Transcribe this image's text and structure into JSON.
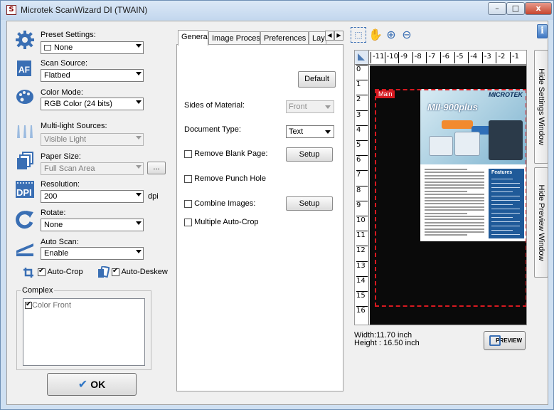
{
  "window": {
    "title": "Microtek ScanWizard DI (TWAIN)",
    "app_icon_glyph": "S",
    "min_glyph": "–",
    "max_glyph": "□",
    "close_glyph": "x"
  },
  "left_panel": {
    "preset": {
      "label": "Preset Settings:",
      "value": "None",
      "icon": "gear-icon"
    },
    "scan_source": {
      "label": "Scan Source:",
      "value": "Flatbed",
      "icon": "af-icon"
    },
    "color_mode": {
      "label": "Color Mode:",
      "value": "RGB Color (24 bits)",
      "icon": "palette-icon"
    },
    "multi_light": {
      "label": "Multi-light Sources:",
      "value": "Visible Light",
      "icon": "light-bars-icon",
      "enabled": false
    },
    "paper_size": {
      "label": "Paper Size:",
      "value": "Full Scan Area",
      "more_label": "...",
      "icon": "paper-stack-icon",
      "enabled": false
    },
    "resolution": {
      "label": "Resolution:",
      "value": "200",
      "unit": "dpi",
      "icon": "dpi-icon"
    },
    "rotate": {
      "label": "Rotate:",
      "value": "None",
      "icon": "rotate-icon"
    },
    "auto_scan": {
      "label": "Auto Scan:",
      "value": "Enable",
      "icon": "scanner-icon"
    },
    "auto_crop": {
      "label": "Auto-Crop",
      "checked": true
    },
    "auto_deskew": {
      "label": "Auto-Deskew",
      "checked": true
    },
    "complex": {
      "label": "Complex",
      "items": [
        {
          "label": "Color Front",
          "checked": true
        }
      ]
    },
    "ok_label": "OK",
    "ok_glyph": "✔"
  },
  "tabs": [
    {
      "label": "General",
      "active": true
    },
    {
      "label": "Image Process",
      "active": false
    },
    {
      "label": "Preferences",
      "active": false
    },
    {
      "label": "Layo",
      "active": false
    }
  ],
  "tab_nav": {
    "prev": "◀",
    "next": "▶"
  },
  "general": {
    "default_label": "Default",
    "sides_of_material": {
      "label": "Sides of Material:",
      "value": "Front",
      "enabled": false
    },
    "document_type": {
      "label": "Document Type:",
      "value": "Text"
    },
    "remove_blank_page": {
      "label": "Remove Blank Page:",
      "checked": false,
      "setup_label": "Setup"
    },
    "remove_punch_hole": {
      "label": "Remove Punch Hole",
      "checked": false
    },
    "combine_images": {
      "label": "Combine Images:",
      "checked": false,
      "setup_label": "Setup"
    },
    "multiple_auto_crop": {
      "label": "Multiple Auto-Crop",
      "checked": false
    }
  },
  "preview": {
    "tools": [
      "select-frame-icon",
      "hand-icon",
      "zoom-in-icon",
      "zoom-out-icon"
    ],
    "tool_glyphs": {
      "select": "⬚",
      "hand": "✋",
      "zoom_in": "⊕",
      "zoom_out": "⊖"
    },
    "h_ruler": [
      "-11",
      "-10",
      "-9",
      "-8",
      "-7",
      "-6",
      "-5",
      "-4",
      "-3",
      "-2",
      "-1"
    ],
    "v_ruler": [
      "0",
      "1",
      "2",
      "3",
      "4",
      "5",
      "6",
      "7",
      "8",
      "9",
      "10",
      "11",
      "12",
      "13",
      "14",
      "15",
      "16"
    ],
    "frame_label": "Main",
    "doc_brand": "MICROTEK",
    "doc_model": "MII-900plus",
    "doc_features": "Features",
    "frame_color": "#d71920",
    "width_text": "Width:11.70 inch",
    "height_text": "Height : 16.50 inch",
    "preview_label": "PREVIEW"
  },
  "side": {
    "info_glyph": "i",
    "hide_settings": "Hide Settings Window",
    "hide_preview": "Hide Preview Window"
  }
}
